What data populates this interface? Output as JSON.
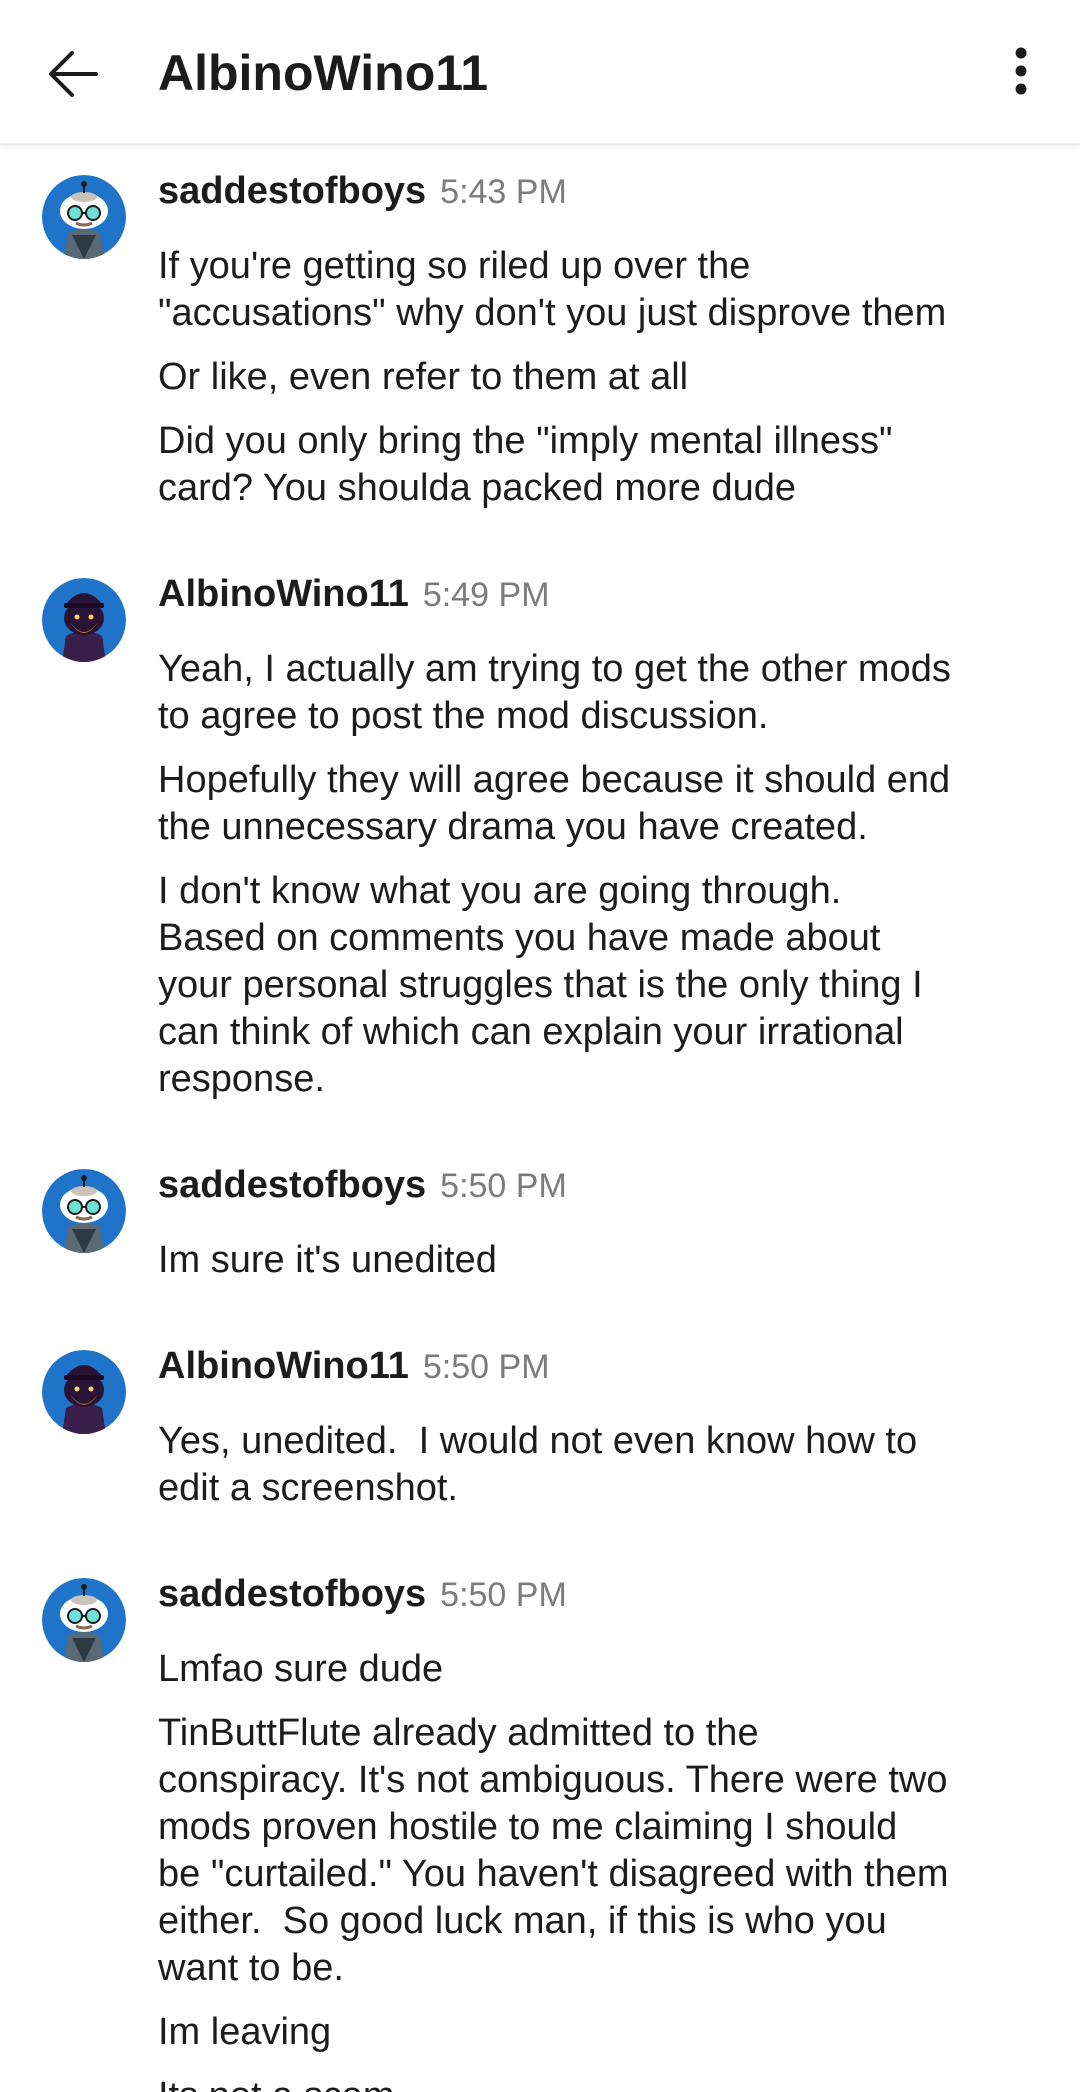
{
  "header": {
    "title": "AlbinoWino11",
    "back_icon": "arrow-left-icon",
    "more_icon": "more-vertical-icon"
  },
  "colors": {
    "avatar_saddest_bg": "#1f74c9",
    "avatar_albino_bg": "#1f74c9",
    "timestamp": "#7c7c7c",
    "text": "#1c1c1c"
  },
  "messages": [
    {
      "user": "saddestofboys",
      "time": "5:43 PM",
      "avatar": "saddestofboys-avatar",
      "lines": [
        "If you're getting so riled up over the\n\"accusations\" why don't you just disprove them",
        "Or like, even refer to them at all",
        "Did you only bring the \"imply mental illness\"\ncard? You shoulda packed more dude"
      ]
    },
    {
      "user": "AlbinoWino11",
      "time": "5:49 PM",
      "avatar": "albinowino11-avatar",
      "lines": [
        "Yeah, I actually am trying to get the other mods\nto agree to post the mod discussion.",
        "Hopefully they will agree because it should end\nthe unnecessary drama you have created.",
        "I don't know what you are going through.\nBased on comments you have made about\nyour personal struggles that is the only thing I\ncan think of which can explain your irrational\nresponse."
      ]
    },
    {
      "user": "saddestofboys",
      "time": "5:50 PM",
      "avatar": "saddestofboys-avatar",
      "lines": [
        "Im sure it's unedited"
      ]
    },
    {
      "user": "AlbinoWino11",
      "time": "5:50 PM",
      "avatar": "albinowino11-avatar",
      "lines": [
        "Yes, unedited.  I would not even know how to\nedit a screenshot."
      ]
    },
    {
      "user": "saddestofboys",
      "time": "5:50 PM",
      "avatar": "saddestofboys-avatar",
      "lines": [
        "Lmfao sure dude",
        "TinButtFlute already admitted to the\nconspiracy. It's not ambiguous. There were two\nmods proven hostile to me claiming I should\nbe \"curtailed.\" You haven't disagreed with them\neither.  So good luck man, if this is who you\nwant to be.",
        "Im leaving",
        "Its not a scam"
      ]
    }
  ]
}
